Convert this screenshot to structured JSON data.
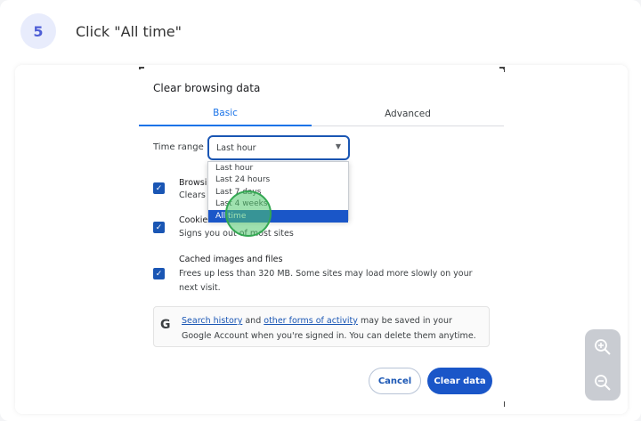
{
  "step": {
    "number": "5",
    "instruction": "Click \"All time\""
  },
  "dialog": {
    "title": "Clear browsing data",
    "tabs": [
      {
        "label": "Basic"
      },
      {
        "label": "Advanced"
      }
    ],
    "time_range": {
      "label": "Time range",
      "value": "Last hour",
      "options": [
        "Last hour",
        "Last 24 hours",
        "Last 7 days",
        "Last 4 weeks",
        "All time"
      ],
      "highlighted": "All time"
    },
    "items": [
      {
        "title": "Browsing history",
        "desc": "Clears history from all synced devices",
        "title_visible": "Browsi",
        "desc_visible": "Clears l"
      },
      {
        "title": "Cookies and other site data",
        "desc": "Signs you out of most sites"
      },
      {
        "title": "Cached images and files",
        "desc": "Frees up less than 320 MB. Some sites may load more slowly on your next visit."
      }
    ],
    "notice": {
      "link1": "Search history",
      "mid1": " and ",
      "link2": "other forms of activity",
      "rest": " may be saved in your Google Account when you're signed in. You can delete them anytime."
    },
    "buttons": {
      "cancel": "Cancel",
      "clear": "Clear data"
    }
  },
  "colors": {
    "accent": "#1a56c8",
    "highlight": "#34a853",
    "badge_bg": "#e8ecfc"
  },
  "icons": {
    "zoom_in": "zoom-in-icon",
    "zoom_out": "zoom-out-icon",
    "checkbox": "check-icon",
    "google": "google-g-icon"
  }
}
